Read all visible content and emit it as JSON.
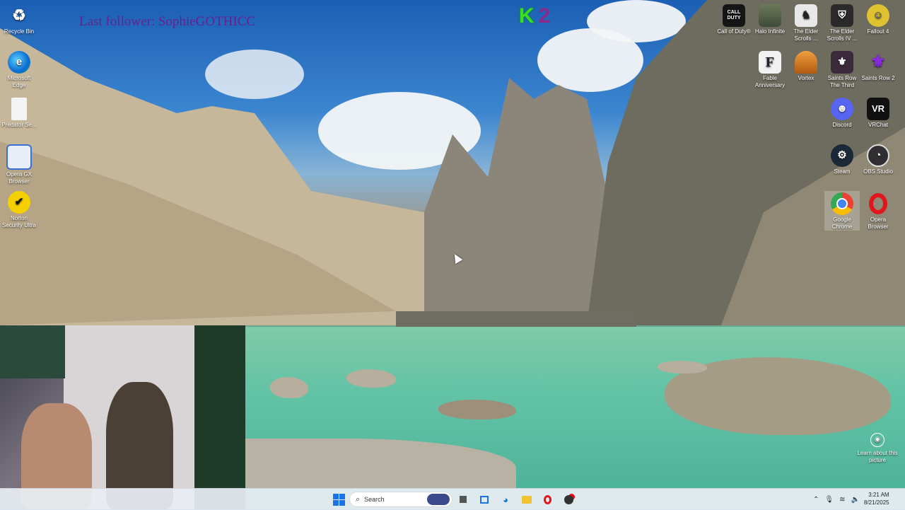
{
  "overlay": {
    "last_follower": "Last follower: SophieGOTHICC",
    "kick_letter": "K",
    "kick_count": "2"
  },
  "desktop_left": [
    {
      "label": "Recycle Bin",
      "icon": "recycle-bin-icon"
    },
    {
      "label": "Microsoft Edge",
      "icon": "edge-icon"
    },
    {
      "label": "Predator Se...",
      "icon": "file-icon"
    },
    {
      "label": "Opera GX Browser",
      "icon": "opera-gx-icon"
    },
    {
      "label": "Norton Security Ultra",
      "icon": "norton-icon"
    }
  ],
  "desktop_right": [
    {
      "label": "Call of Duty®",
      "icon": "call-of-duty-icon"
    },
    {
      "label": "Halo Infinite",
      "icon": "halo-icon"
    },
    {
      "label": "The Elder Scrolls ...",
      "icon": "elder-scrolls-icon"
    },
    {
      "label": "The Elder Scrolls IV ...",
      "icon": "elder-scrolls-iv-icon"
    },
    {
      "label": "Fallout 4",
      "icon": "fallout-icon"
    },
    {
      "label": "Fable Anniversary",
      "icon": "fable-icon"
    },
    {
      "label": "Vortex",
      "icon": "vortex-icon"
    },
    {
      "label": "Saints Row The Third",
      "icon": "saints-row-third-icon"
    },
    {
      "label": "Saints Row 2",
      "icon": "saints-row-2-icon"
    },
    {
      "label": "Discord",
      "icon": "discord-icon"
    },
    {
      "label": "VRChat",
      "icon": "vrchat-icon"
    },
    {
      "label": "Steam",
      "icon": "steam-icon"
    },
    {
      "label": "OBS Studio",
      "icon": "obs-icon"
    },
    {
      "label": "Google Chrome",
      "icon": "chrome-icon"
    },
    {
      "label": "Opera Browser",
      "icon": "opera-icon"
    }
  ],
  "glyphs": {
    "call_of_duty": "CALL\nDUTY",
    "vrchat": "VR"
  },
  "wallpaper": {
    "learn_label": "Learn about this picture"
  },
  "taskbar": {
    "search_placeholder": "Search",
    "time": "3:21 AM",
    "date": "8/21/2025"
  }
}
